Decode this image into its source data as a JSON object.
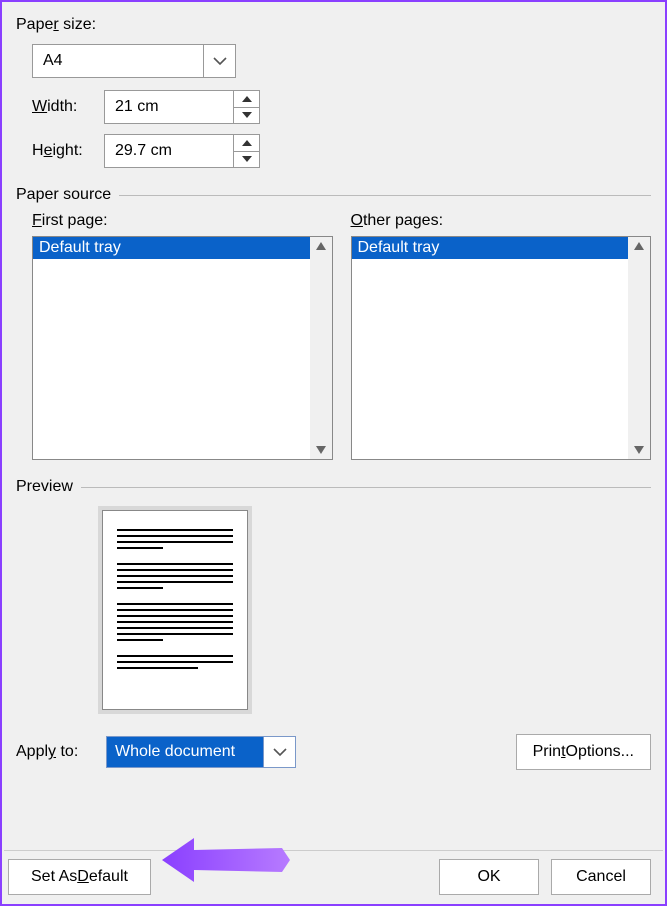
{
  "paper_size": {
    "label_pre": "Pape",
    "label_u": "r",
    "label_post": " size:",
    "selected": "A4",
    "width_label_u": "W",
    "width_label_post": "idth:",
    "width_value": "21 cm",
    "height_label_pre": "H",
    "height_label_u": "e",
    "height_label_post": "ight:",
    "height_value": "29.7 cm"
  },
  "paper_source": {
    "title": "Paper source",
    "first_u": "F",
    "first_post": "irst page:",
    "other_u": "O",
    "other_post": "ther pages:",
    "first_selected": "Default tray",
    "other_selected": "Default tray"
  },
  "preview": {
    "title": "Preview"
  },
  "apply": {
    "label_pre": "Appl",
    "label_u": "y",
    "label_post": " to:",
    "value": "Whole document",
    "print_options_pre": "Prin",
    "print_options_u": "t",
    "print_options_post": " Options..."
  },
  "footer": {
    "set_default_pre": "Set As ",
    "set_default_u": "D",
    "set_default_post": "efault",
    "ok": "OK",
    "cancel": "Cancel"
  }
}
